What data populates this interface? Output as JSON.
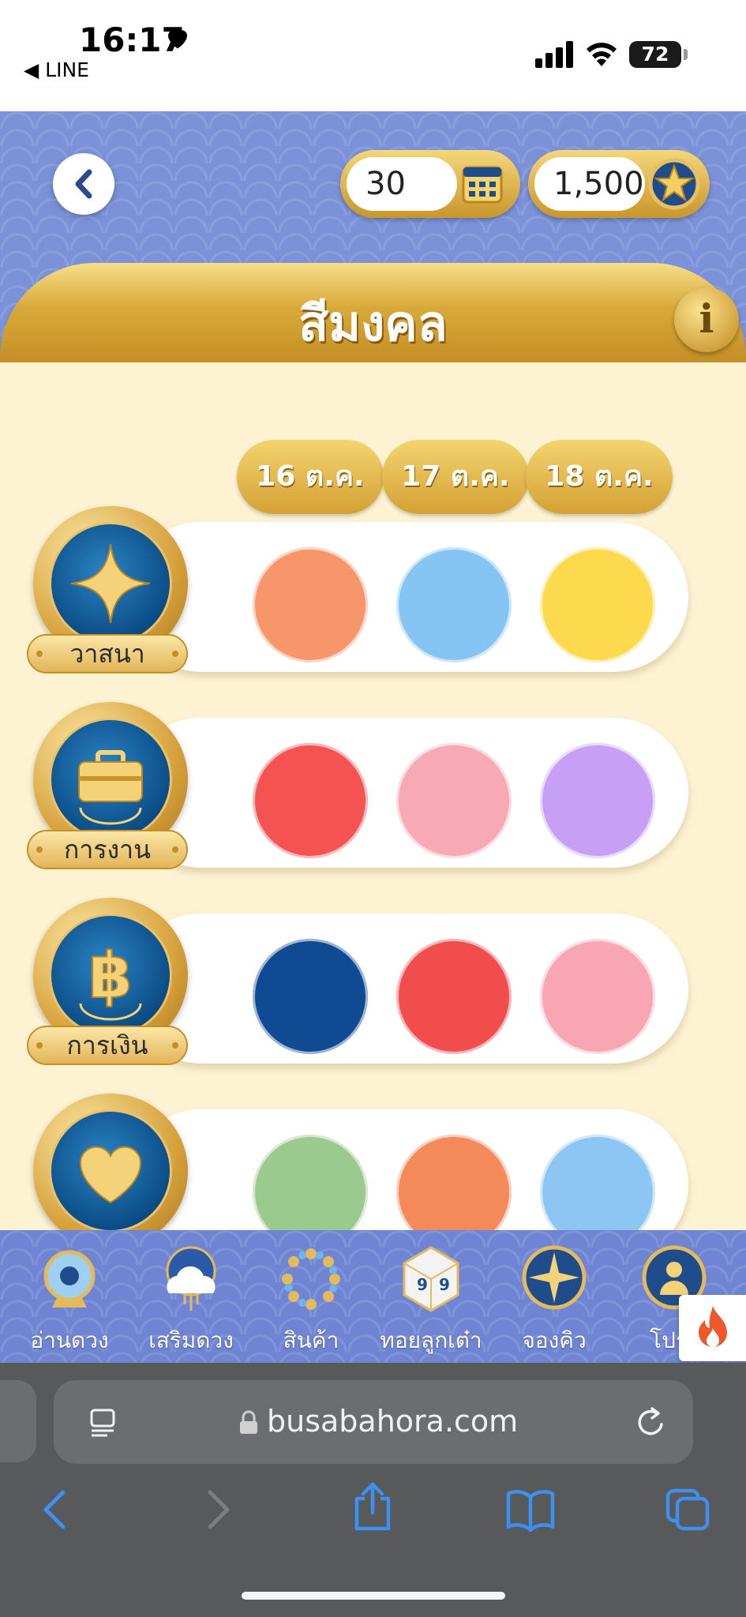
{
  "status_bar": {
    "time": "16:17",
    "back_app": "◀ LINE",
    "battery": "72"
  },
  "header": {
    "days_remaining": "30",
    "coins": "1,500",
    "title": "สีมงคล",
    "info_glyph": "i"
  },
  "dates": [
    "16 ต.ค.",
    "17 ต.ค.",
    "18 ต.ค."
  ],
  "categories": [
    {
      "label": "วาสนา",
      "icon": "sparkle-star-icon",
      "colors": [
        "#f7966b",
        "#86c4f3",
        "#fcd94d"
      ]
    },
    {
      "label": "การงาน",
      "icon": "briefcase-icon",
      "colors": [
        "#f55252",
        "#f7a9b5",
        "#c7a0f5"
      ]
    },
    {
      "label": "การเงิน",
      "icon": "baht-icon",
      "colors": [
        "#0f4a92",
        "#f24d4d",
        "#f8a6b4"
      ]
    },
    {
      "label": "",
      "icon": "heart-icon",
      "colors": [
        "#9bc98e",
        "#f48a5a",
        "#8ec6f3"
      ]
    }
  ],
  "bottom_nav": {
    "items": [
      {
        "label": "อ่านดวง",
        "icon": "crystal-ball-icon"
      },
      {
        "label": "เสริมดวง",
        "icon": "cloud-shine-icon"
      },
      {
        "label": "สินค้า",
        "icon": "bead-bracelet-icon"
      },
      {
        "label": "ทอยลูกเต๋า",
        "icon": "dice-icon"
      },
      {
        "label": "จองคิว",
        "icon": "compass-icon"
      },
      {
        "label": "โปรไ",
        "icon": "profile-icon"
      }
    ]
  },
  "browser": {
    "url": "busabahora.com"
  },
  "colors": {
    "header_blue": "#7b92d8",
    "gold": "#d4a135",
    "cream": "#fdf3d3"
  }
}
